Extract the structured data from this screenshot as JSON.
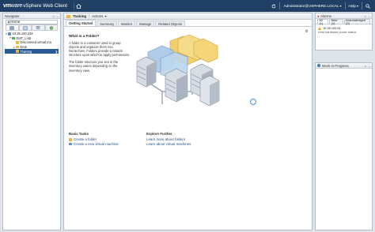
{
  "app": {
    "brand_vm": "vm",
    "brand_ware": "ware",
    "brand_rest": "vSphere Web Client",
    "user": "Administrator@VSPHERE.LOCAL",
    "help": "Help"
  },
  "navigator": {
    "title": "Navigator",
    "history": "Home",
    "tree": [
      {
        "label": "10.35.100.234",
        "level": 0,
        "twisty": "▾",
        "icon_color": "#6b8fb8"
      },
      {
        "label": "EMT_LAB",
        "level": 1,
        "twisty": "▾",
        "icon_color": "#5c9e5c"
      },
      {
        "label": "Discovered virtual ma",
        "level": 2,
        "twisty": "",
        "icon_color": "#e7b844"
      },
      {
        "label": "Emit",
        "level": 2,
        "twisty": "▸",
        "icon_color": "#e7b844"
      },
      {
        "label": "Training",
        "level": 2,
        "twisty": "",
        "icon_color": "#e7b844",
        "selected": true
      }
    ]
  },
  "main": {
    "title": "Training",
    "actions_label": "Actions",
    "tabs": [
      "Getting Started",
      "Summary",
      "Monitor",
      "Manage",
      "Related Objects"
    ],
    "active_tab": 0,
    "heading": "What is a Folder?",
    "para1": "A folder is a container used to group objects and organize them into hierarchies. Folders provide a natural structure upon which to apply permissions.",
    "para2": "The folder structure you see in the inventory varies depending on the inventory view.",
    "basic_tasks": {
      "heading": "Basic Tasks",
      "items": [
        {
          "label": "Create a folder",
          "icon_color": "#e7b844"
        },
        {
          "label": "Create a new virtual machine",
          "icon_color": "#6b8fb8"
        }
      ]
    },
    "explore": {
      "heading": "Explore Further",
      "items": [
        {
          "label": "Learn more about folders"
        },
        {
          "label": "Learn about virtual machines"
        }
      ]
    }
  },
  "alarms": {
    "title": "Alarms",
    "tabs": [
      "All (1)",
      "New (1)",
      "Acknowledged (0)"
    ],
    "item_host": "10.35.100.51",
    "item_desc": "Host hardware power status"
  },
  "wip": {
    "title": "Work In Progress"
  }
}
